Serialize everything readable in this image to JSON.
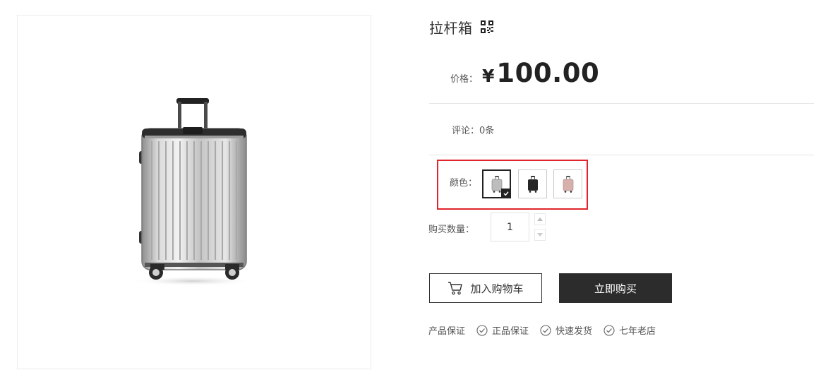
{
  "product": {
    "title": "拉杆箱",
    "qr_icon": "qr-code-icon",
    "price_label": "价格：",
    "currency_symbol": "¥",
    "price": "100.00",
    "comment_label": "评论：",
    "comment_count": "0条"
  },
  "color": {
    "label": "颜色：",
    "options": [
      {
        "name": "silver",
        "hex": "#b8b8b8",
        "selected": true
      },
      {
        "name": "black",
        "hex": "#262626",
        "selected": false
      },
      {
        "name": "pink",
        "hex": "#d7b0ad",
        "selected": false
      }
    ],
    "highlight_color": "#e0252c"
  },
  "quantity": {
    "label": "购买数量：",
    "value": "1"
  },
  "actions": {
    "add_to_cart": "加入购物车",
    "buy_now": "立即购买"
  },
  "guarantee": {
    "label": "产品保证",
    "items": [
      "正品保证",
      "快速发货",
      "七年老店"
    ]
  }
}
